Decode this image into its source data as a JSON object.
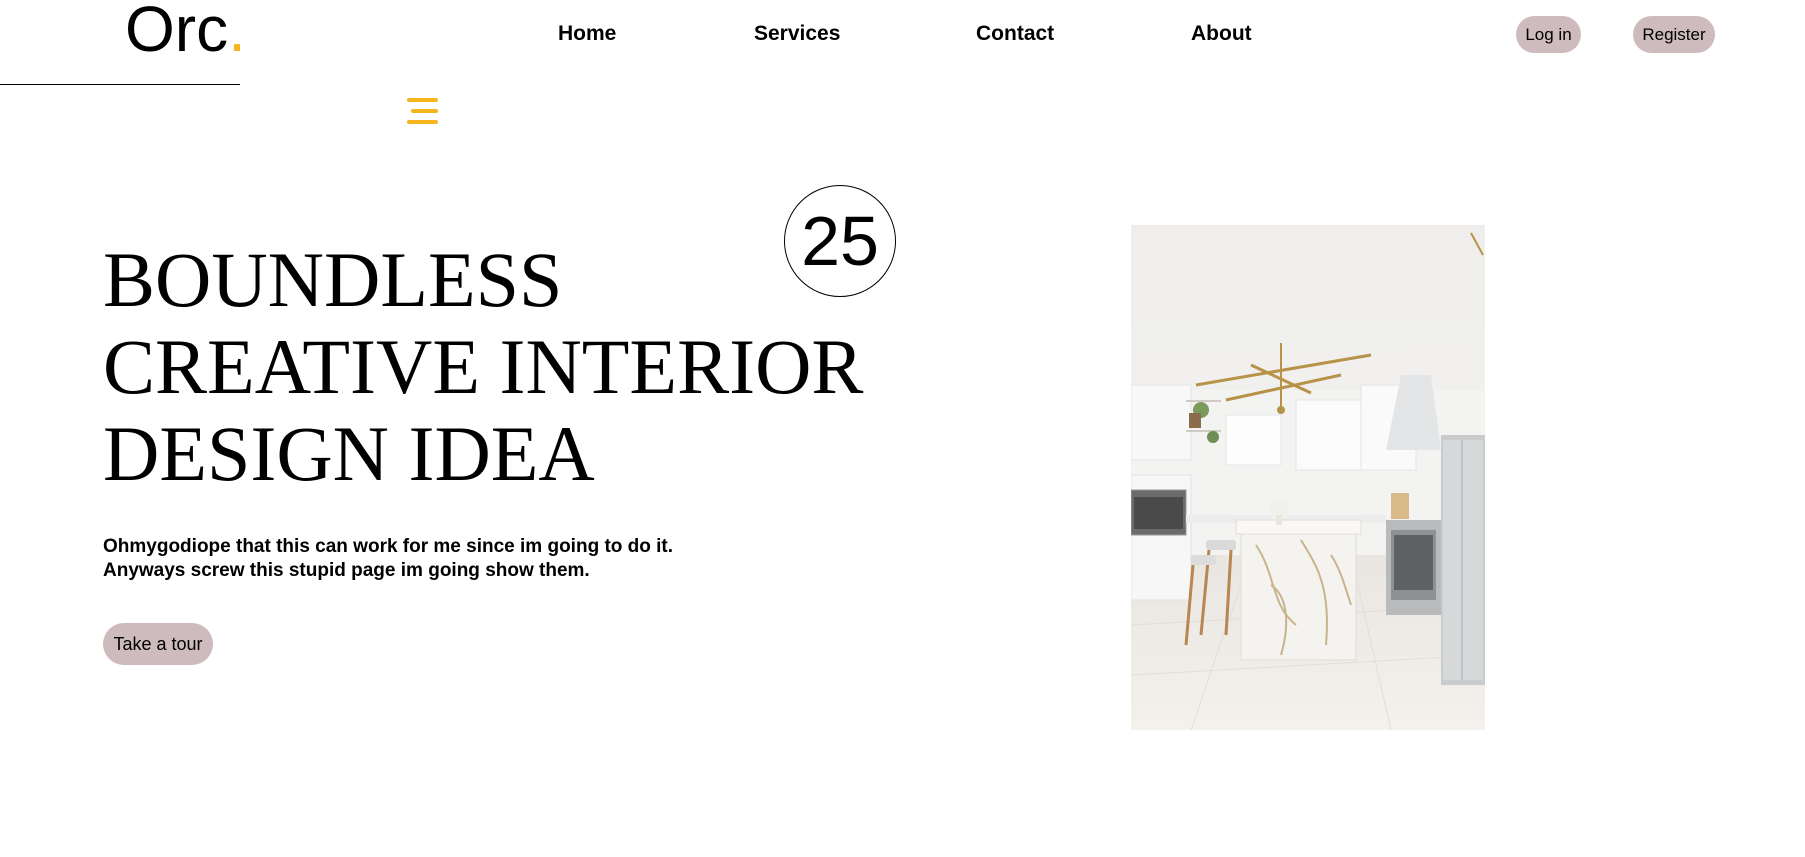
{
  "brand": {
    "name": "Orc",
    "dot": "."
  },
  "nav": {
    "items": [
      {
        "label": "Home"
      },
      {
        "label": "Services"
      },
      {
        "label": "Contact"
      },
      {
        "label": "About"
      }
    ],
    "login_label": "Log in",
    "register_label": "Register",
    "menu_icon": "hamburger-menu-icon"
  },
  "hero": {
    "badge_number": "25",
    "headline_lines": [
      "BOUNDLESS",
      "CREATIVE INTERIOR",
      "DESIGN IDEA"
    ],
    "subtext_lines": [
      "Ohmygodiope that this can work for me since im going to do it.",
      "Anyways screw this stupid page im going show them."
    ],
    "cta_label": "Take a tour",
    "image_subject": "white-kitchen-interior"
  },
  "colors": {
    "accent": "#f5b51d",
    "pill": "#cdbbbd",
    "text": "#000000",
    "background": "#ffffff"
  }
}
